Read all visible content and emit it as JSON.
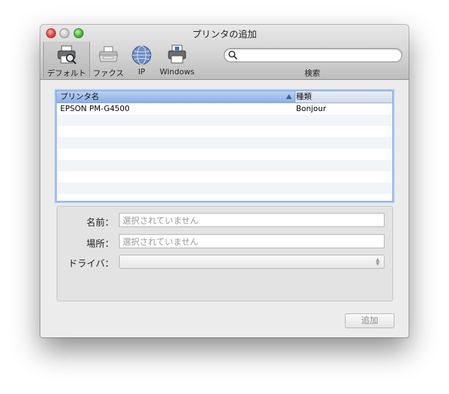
{
  "window": {
    "title": "プリンタの追加"
  },
  "toolbar": {
    "items": [
      {
        "label": "デフォルト",
        "icon": "printer-magnifier-icon",
        "selected": true
      },
      {
        "label": "ファクス",
        "icon": "fax-icon",
        "selected": false
      },
      {
        "label": "IP",
        "icon": "globe-icon",
        "selected": false
      },
      {
        "label": "Windows",
        "icon": "windows-printer-icon",
        "selected": false
      }
    ],
    "search": {
      "placeholder": "",
      "label": "検索",
      "icon": "search-icon"
    }
  },
  "printer_list": {
    "columns": {
      "name": "プリンタ名",
      "kind": "種類"
    },
    "rows": [
      {
        "name": "EPSON PM-G4500",
        "kind": "Bonjour"
      }
    ]
  },
  "details": {
    "name_label": "名前：",
    "name_value": "選択されていません",
    "location_label": "場所：",
    "location_value": "選択されていません",
    "driver_label": "ドライバ：",
    "driver_value": ""
  },
  "footer": {
    "add_label": "追加"
  },
  "colors": {
    "selection_blue": "#89aee6",
    "focus_ring": "#a9c8f5"
  }
}
